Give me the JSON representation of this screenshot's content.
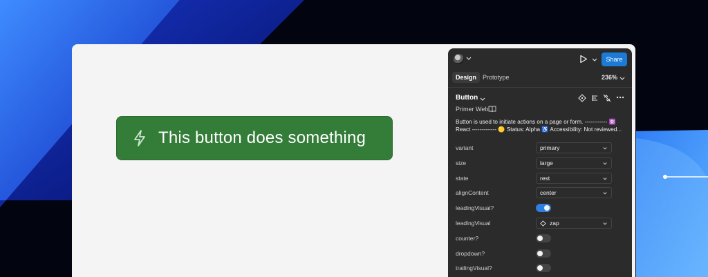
{
  "colors": {
    "page_bg": "#02040f",
    "canvas_bg": "#f4f4f5",
    "button_green": "#347d39",
    "panel_bg": "#2b2b2b",
    "accent_blue": "#1b7bd6",
    "toggle_on": "#2f7fe0"
  },
  "demo": {
    "button_label": "This button does something",
    "button_icon": "zap-icon"
  },
  "panel": {
    "topbar": {
      "share_label": "Share"
    },
    "tabs": {
      "design": "Design",
      "prototype": "Prototype",
      "zoom": "236%"
    },
    "component": {
      "name": "Button",
      "library": "Primer Web",
      "description_line1": "Button is used to initiate actions on a page or form. ------------ ⚛️",
      "description_line2": "React ------------- 🟡 Status: Alpha ♿ Accessibility: Not reviewed..."
    },
    "properties": [
      {
        "label": "variant",
        "type": "select",
        "value": "primary"
      },
      {
        "label": "size",
        "type": "select",
        "value": "large"
      },
      {
        "label": "state",
        "type": "select",
        "value": "rest"
      },
      {
        "label": "alignContent",
        "type": "select",
        "value": "center"
      },
      {
        "label": "leadingVisual?",
        "type": "toggle",
        "on": true
      },
      {
        "label": "leadingVisual",
        "type": "select",
        "value": "zap",
        "icon": "diamond-icon"
      },
      {
        "label": "counter?",
        "type": "toggle",
        "on": false
      },
      {
        "label": "dropdown?",
        "type": "toggle",
        "on": false
      },
      {
        "label": "trailingVisual?",
        "type": "toggle",
        "on": false
      }
    ]
  }
}
